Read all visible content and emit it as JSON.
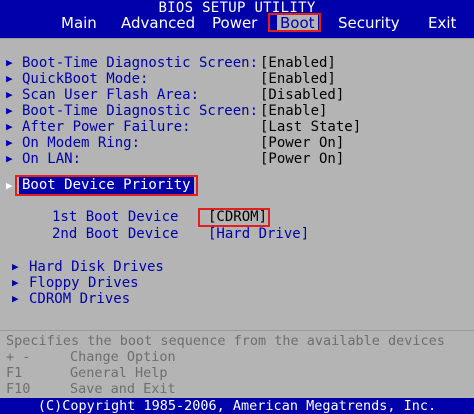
{
  "window": {
    "title": "BIOS SETUP UTILITY"
  },
  "menu": {
    "tabs": [
      {
        "label": "Main"
      },
      {
        "label": "Advanced"
      },
      {
        "label": "Power"
      },
      {
        "label": "Boot",
        "active": true
      },
      {
        "label": "Security"
      },
      {
        "label": "Exit"
      }
    ]
  },
  "options": [
    {
      "label": "Boot-Time Diagnostic Screen:",
      "value": "[Enabled]"
    },
    {
      "label": "QuickBoot Mode:",
      "value": "[Enabled]"
    },
    {
      "label": "Scan User Flash Area:",
      "value": "[Disabled]"
    },
    {
      "label": "Boot-Time Diagnostic Screen:",
      "value": "[Enable]"
    },
    {
      "label": "After Power Failure:",
      "value": "[Last State]"
    },
    {
      "label": "On Modem Ring:",
      "value": "[Power On]"
    },
    {
      "label": "On LAN:",
      "value": "[Power On]"
    }
  ],
  "boot_priority": {
    "label": "Boot Device Priority",
    "devices": [
      {
        "label": "1st Boot Device",
        "value": "[CDROM]"
      },
      {
        "label": "2nd Boot Device",
        "value": "[Hard Drive]"
      }
    ]
  },
  "submenus": [
    {
      "label": "Hard Disk Drives"
    },
    {
      "label": "Floppy Drives"
    },
    {
      "label": "CDROM Drives"
    }
  ],
  "help": {
    "description": "Specifies the boot sequence from the available devices",
    "keys": [
      {
        "key": "+ -",
        "action": "Change Option"
      },
      {
        "key": "F1",
        "action": "General Help"
      },
      {
        "key": "F10",
        "action": "Save and Exit"
      }
    ]
  },
  "footer": {
    "copyright": "(C)Copyright 1985-2006, American Megatrends, Inc."
  },
  "colors": {
    "background_blue": "#0000aa",
    "panel_gray": "#b4b4b4",
    "highlight_red": "#e02020",
    "text_white": "#ffffff"
  }
}
